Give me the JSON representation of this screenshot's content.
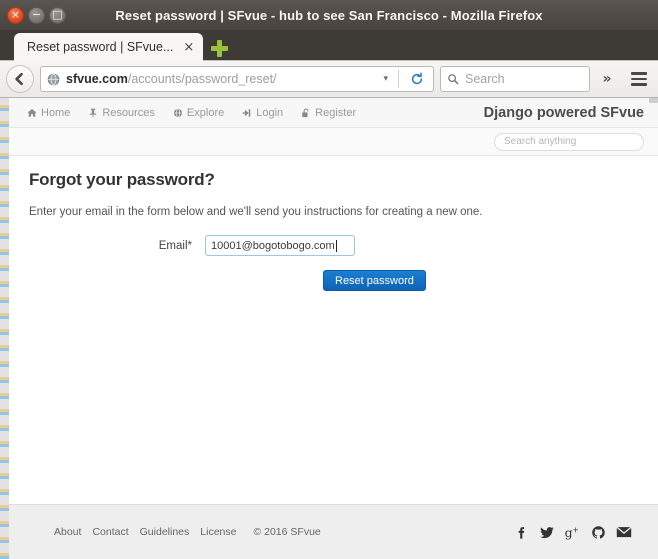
{
  "window": {
    "title": "Reset password | SFvue - hub to see San Francisco - Mozilla Firefox",
    "close_label": "×",
    "minimize_label": "−",
    "maximize_label": "□"
  },
  "browser": {
    "tab": {
      "title": "Reset password | SFvue...",
      "close_label": "×"
    },
    "new_tab_label": "+",
    "back_label": "Back",
    "url": {
      "domain": "sfvue.com",
      "path": "/accounts/password_reset/",
      "dropdown_label": "▾"
    },
    "reload_label": "Reload",
    "search": {
      "placeholder": "Search",
      "icon": "search-icon"
    },
    "overflow_label": "»",
    "menu_label": "Open menu"
  },
  "site": {
    "nav_items": [
      {
        "label": "Home",
        "icon": "home-icon"
      },
      {
        "label": "Resources",
        "icon": "thumbtack-icon"
      },
      {
        "label": "Explore",
        "icon": "globe-icon"
      },
      {
        "label": "Login",
        "icon": "sign-in-icon"
      },
      {
        "label": "Register",
        "icon": "unlock-icon"
      }
    ],
    "brand": "Django powered SFvue",
    "search_placeholder": "Search anything"
  },
  "main": {
    "title": "Forgot your password?",
    "intro": "Enter your email in the form below and we'll send you instructions for creating a new one.",
    "form": {
      "email_label": "Email*",
      "email_value": "10001@bogotobogo.com",
      "submit_label": "Reset password"
    }
  },
  "footer": {
    "links": [
      "About",
      "Contact",
      "Guidelines",
      "License"
    ],
    "copyright": "© 2016 SFvue",
    "socials": [
      {
        "name": "facebook-icon"
      },
      {
        "name": "twitter-icon"
      },
      {
        "name": "google-plus-icon"
      },
      {
        "name": "github-icon"
      },
      {
        "name": "email-icon"
      }
    ]
  }
}
